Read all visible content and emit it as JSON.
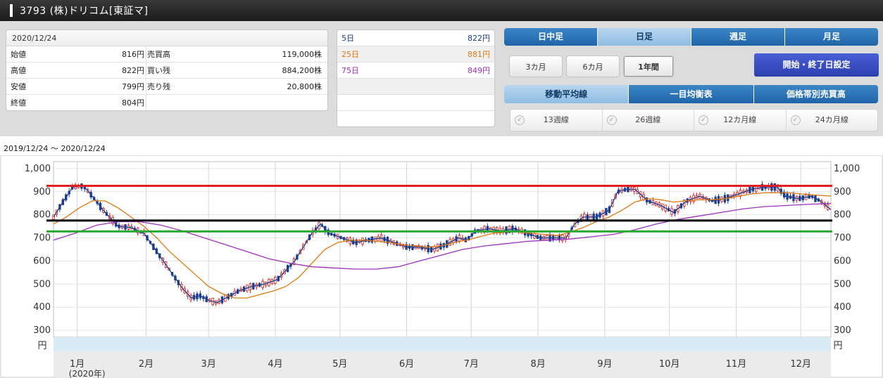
{
  "header": {
    "title": "3793 (株)ドリコム[東証マ]"
  },
  "quote": {
    "date": "2020/12/24",
    "rows": [
      {
        "l1": "始値",
        "v1": "816円",
        "l2": "売買高",
        "v2": "119,000株"
      },
      {
        "l1": "高値",
        "v1": "822円",
        "l2": "買い残",
        "v2": "884,200株"
      },
      {
        "l1": "安値",
        "v1": "799円",
        "l2": "売り残",
        "v2": "20,800株"
      },
      {
        "l1": "終値",
        "v1": "804円",
        "l2": "",
        "v2": ""
      }
    ]
  },
  "ma": [
    {
      "label": "5日",
      "value": "822円",
      "color": "#1c3d8a"
    },
    {
      "label": "25日",
      "value": "881円",
      "color": "#e07810"
    },
    {
      "label": "75日",
      "value": "849円",
      "color": "#a030c0"
    }
  ],
  "period_tabs": [
    {
      "label": "日中足",
      "selected": false
    },
    {
      "label": "日足",
      "selected": true
    },
    {
      "label": "週足",
      "selected": false
    },
    {
      "label": "月足",
      "selected": false
    }
  ],
  "range_buttons": [
    {
      "label": "3カ月",
      "selected": false
    },
    {
      "label": "6カ月",
      "selected": false
    },
    {
      "label": "1年間",
      "selected": true
    }
  ],
  "range_setting_button": "開始・終了日設定",
  "indicator_tabs": [
    {
      "label": "移動平均線",
      "selected": true
    },
    {
      "label": "一目均衡表",
      "selected": false
    },
    {
      "label": "価格帯別売買高",
      "selected": false
    }
  ],
  "week_lines": [
    {
      "label": "13週線",
      "checked": false
    },
    {
      "label": "26週線",
      "checked": false
    },
    {
      "label": "12カ月線",
      "checked": false
    },
    {
      "label": "24カ月線",
      "checked": false
    }
  ],
  "date_range": "2019/12/24 ～ 2020/12/24",
  "chart_data": {
    "type": "candlestick",
    "unit": "円",
    "ylim": [
      270,
      1030
    ],
    "y_ticks": [
      "1,000",
      "900",
      "800",
      "700",
      "600",
      "500",
      "400",
      "300"
    ],
    "y_tick_values": [
      1000,
      900,
      800,
      700,
      600,
      500,
      400,
      300
    ],
    "months": [
      "1月",
      "2月",
      "3月",
      "4月",
      "5月",
      "6月",
      "7月",
      "8月",
      "9月",
      "10月",
      "11月",
      "12月"
    ],
    "year_label": "(2020年)",
    "horizontal_lines": [
      {
        "value": 925,
        "color": "#e02020"
      },
      {
        "value": 775,
        "color": "#000000"
      },
      {
        "value": 728,
        "color": "#2aa830"
      }
    ],
    "ma_series": [
      {
        "name": "5日",
        "color": "#1c3d8a",
        "points": [
          [
            0,
            790
          ],
          [
            4,
            850
          ],
          [
            9,
            920
          ],
          [
            14,
            925
          ],
          [
            18,
            880
          ],
          [
            24,
            810
          ],
          [
            30,
            750
          ],
          [
            36,
            745
          ],
          [
            42,
            720
          ],
          [
            48,
            640
          ],
          [
            54,
            560
          ],
          [
            60,
            480
          ],
          [
            64,
            440
          ],
          [
            68,
            450
          ],
          [
            72,
            430
          ],
          [
            76,
            420
          ],
          [
            80,
            440
          ],
          [
            86,
            470
          ],
          [
            92,
            490
          ],
          [
            98,
            500
          ],
          [
            104,
            520
          ],
          [
            108,
            560
          ],
          [
            112,
            600
          ],
          [
            116,
            660
          ],
          [
            120,
            720
          ],
          [
            124,
            760
          ],
          [
            128,
            720
          ],
          [
            134,
            700
          ],
          [
            140,
            680
          ],
          [
            146,
            690
          ],
          [
            152,
            700
          ],
          [
            158,
            680
          ],
          [
            164,
            660
          ],
          [
            170,
            660
          ],
          [
            176,
            650
          ],
          [
            182,
            670
          ],
          [
            188,
            700
          ],
          [
            192,
            690
          ],
          [
            196,
            730
          ],
          [
            202,
            740
          ],
          [
            208,
            730
          ],
          [
            214,
            740
          ],
          [
            220,
            720
          ],
          [
            226,
            700
          ],
          [
            232,
            700
          ],
          [
            238,
            700
          ],
          [
            242,
            760
          ],
          [
            246,
            790
          ],
          [
            252,
            790
          ],
          [
            258,
            820
          ],
          [
            262,
            900
          ],
          [
            266,
            910
          ],
          [
            270,
            910
          ],
          [
            276,
            860
          ],
          [
            282,
            840
          ],
          [
            288,
            810
          ],
          [
            294,
            860
          ],
          [
            300,
            880
          ],
          [
            306,
            860
          ],
          [
            312,
            870
          ],
          [
            318,
            890
          ],
          [
            324,
            910
          ],
          [
            330,
            920
          ],
          [
            336,
            920
          ],
          [
            340,
            880
          ],
          [
            346,
            870
          ],
          [
            352,
            880
          ],
          [
            356,
            860
          ],
          [
            361,
            822
          ]
        ]
      },
      {
        "name": "25日",
        "color": "#e07810",
        "points": [
          [
            0,
            760
          ],
          [
            6,
            790
          ],
          [
            12,
            830
          ],
          [
            18,
            860
          ],
          [
            24,
            860
          ],
          [
            30,
            830
          ],
          [
            36,
            790
          ],
          [
            42,
            750
          ],
          [
            48,
            700
          ],
          [
            54,
            640
          ],
          [
            60,
            590
          ],
          [
            66,
            540
          ],
          [
            72,
            490
          ],
          [
            78,
            460
          ],
          [
            84,
            440
          ],
          [
            90,
            440
          ],
          [
            96,
            455
          ],
          [
            102,
            470
          ],
          [
            108,
            490
          ],
          [
            114,
            530
          ],
          [
            120,
            590
          ],
          [
            126,
            650
          ],
          [
            132,
            680
          ],
          [
            138,
            690
          ],
          [
            144,
            690
          ],
          [
            150,
            685
          ],
          [
            156,
            680
          ],
          [
            162,
            670
          ],
          [
            168,
            665
          ],
          [
            174,
            660
          ],
          [
            180,
            665
          ],
          [
            186,
            680
          ],
          [
            192,
            690
          ],
          [
            198,
            705
          ],
          [
            204,
            720
          ],
          [
            210,
            725
          ],
          [
            216,
            725
          ],
          [
            222,
            720
          ],
          [
            228,
            715
          ],
          [
            234,
            710
          ],
          [
            240,
            725
          ],
          [
            246,
            745
          ],
          [
            252,
            770
          ],
          [
            258,
            790
          ],
          [
            264,
            820
          ],
          [
            270,
            855
          ],
          [
            276,
            870
          ],
          [
            282,
            865
          ],
          [
            288,
            855
          ],
          [
            294,
            860
          ],
          [
            300,
            865
          ],
          [
            306,
            865
          ],
          [
            312,
            870
          ],
          [
            318,
            880
          ],
          [
            324,
            890
          ],
          [
            330,
            895
          ],
          [
            336,
            895
          ],
          [
            342,
            895
          ],
          [
            348,
            890
          ],
          [
            354,
            885
          ],
          [
            361,
            881
          ]
        ]
      },
      {
        "name": "75日",
        "color": "#a030c0",
        "points": [
          [
            0,
            690
          ],
          [
            10,
            720
          ],
          [
            20,
            755
          ],
          [
            30,
            770
          ],
          [
            40,
            770
          ],
          [
            50,
            755
          ],
          [
            60,
            730
          ],
          [
            70,
            700
          ],
          [
            80,
            670
          ],
          [
            90,
            640
          ],
          [
            100,
            610
          ],
          [
            110,
            590
          ],
          [
            120,
            575
          ],
          [
            130,
            570
          ],
          [
            140,
            565
          ],
          [
            150,
            565
          ],
          [
            160,
            575
          ],
          [
            170,
            600
          ],
          [
            180,
            625
          ],
          [
            190,
            650
          ],
          [
            200,
            665
          ],
          [
            210,
            675
          ],
          [
            220,
            685
          ],
          [
            230,
            690
          ],
          [
            240,
            695
          ],
          [
            250,
            705
          ],
          [
            260,
            715
          ],
          [
            270,
            735
          ],
          [
            280,
            760
          ],
          [
            290,
            780
          ],
          [
            300,
            795
          ],
          [
            310,
            810
          ],
          [
            320,
            825
          ],
          [
            330,
            835
          ],
          [
            340,
            840
          ],
          [
            350,
            845
          ],
          [
            361,
            849
          ]
        ]
      }
    ]
  }
}
